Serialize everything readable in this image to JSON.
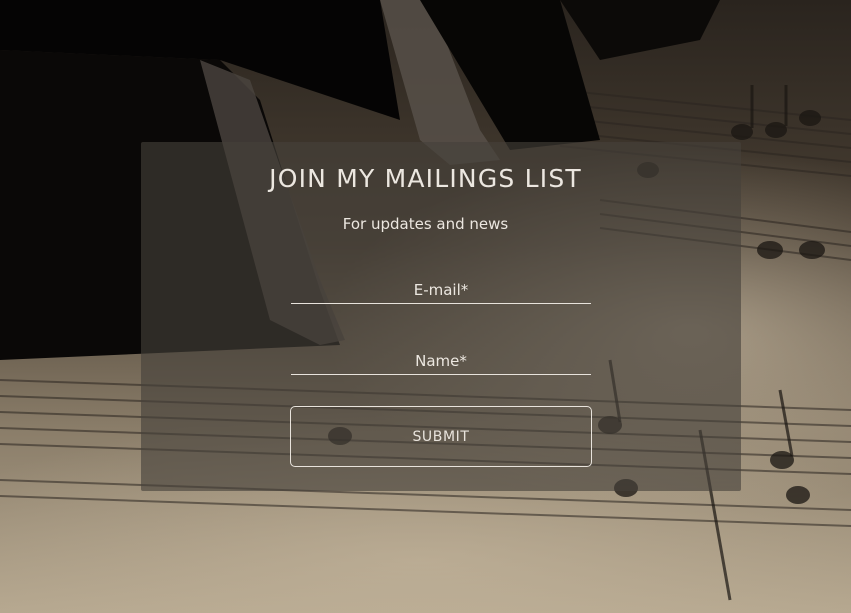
{
  "signup": {
    "title": "JOIN MY MAILINGS LIST",
    "subtitle": "For updates and news",
    "email_placeholder": "E-mail*",
    "name_placeholder": "Name*",
    "submit_label": "SUBMIT"
  }
}
